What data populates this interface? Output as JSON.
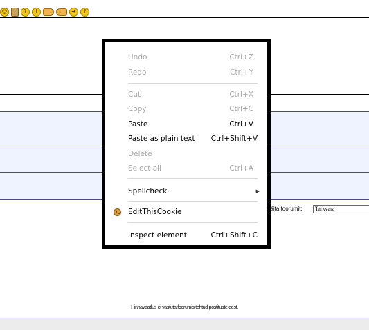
{
  "toolbar": {
    "icons": [
      "smiley-icon",
      "trash-icon",
      "question-icon",
      "exclamation-icon",
      "hand-right-icon",
      "hand-left-icon",
      "arrow-icon",
      "idea-icon"
    ],
    "glyphs": [
      "☺",
      "",
      "?",
      "!",
      "",
      "",
      "➜",
      "?"
    ]
  },
  "forum": {
    "label": "näita foorumit:",
    "selected": "Tarkvara"
  },
  "footer": {
    "text": "Hinnavaatlus ei vastuta foorumis tehtud postituste eest."
  },
  "context_menu": {
    "items": [
      {
        "label": "Undo",
        "shortcut": "Ctrl+Z",
        "enabled": false
      },
      {
        "label": "Redo",
        "shortcut": "Ctrl+Y",
        "enabled": false
      },
      {
        "label": "Cut",
        "shortcut": "Ctrl+X",
        "enabled": false
      },
      {
        "label": "Copy",
        "shortcut": "Ctrl+C",
        "enabled": false
      },
      {
        "label": "Paste",
        "shortcut": "Ctrl+V",
        "enabled": true
      },
      {
        "label": "Paste as plain text",
        "shortcut": "Ctrl+Shift+V",
        "enabled": true
      },
      {
        "label": "Delete",
        "shortcut": "",
        "enabled": false
      },
      {
        "label": "Select all",
        "shortcut": "Ctrl+A",
        "enabled": false
      },
      {
        "label": "Spellcheck",
        "shortcut": "",
        "enabled": true,
        "submenu": true
      },
      {
        "label": "EditThisCookie",
        "shortcut": "",
        "enabled": true,
        "icon": "cookie-icon"
      },
      {
        "label": "Inspect element",
        "shortcut": "Ctrl+Shift+C",
        "enabled": true
      }
    ]
  },
  "colors": {
    "band": "#eef3ff",
    "menu_border": "#000000",
    "disabled_text": "#a8a8a8"
  }
}
